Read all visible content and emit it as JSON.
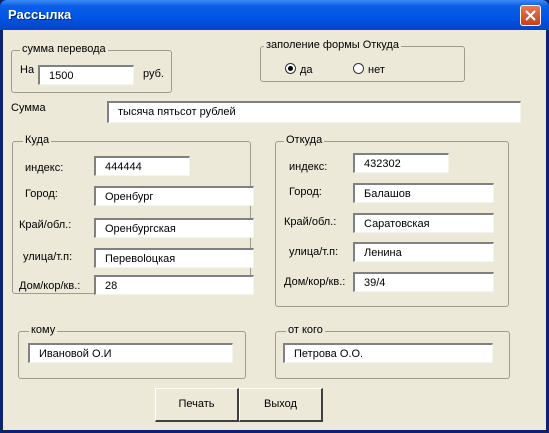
{
  "window": {
    "title": "Рассылка"
  },
  "transfer": {
    "group_label": "сумма перевода",
    "prefix": "На",
    "amount": "1500",
    "currency": "руб."
  },
  "form_from": {
    "group_label": "заполение формы Откуда",
    "option_yes": "да",
    "option_no": "нет",
    "selected": "да"
  },
  "sum": {
    "label": "Сумма",
    "value": "тысяча пятьсот рублей"
  },
  "to_address": {
    "group_label": "Куда",
    "fields": [
      {
        "label": "индекс:",
        "value": "444444"
      },
      {
        "label": "Город:",
        "value": "Оренбург"
      },
      {
        "label": "Край/обл.:",
        "value": "Оренбургская"
      },
      {
        "label": "улица/т.п:",
        "value": "Перевolоцкая"
      },
      {
        "label": "Дом/кор/кв.:",
        "value": "28"
      }
    ]
  },
  "from_address": {
    "group_label": "Откуда",
    "fields": [
      {
        "label": "индекс:",
        "value": "432302"
      },
      {
        "label": "Город:",
        "value": "Балашов"
      },
      {
        "label": "Край/обл.:",
        "value": "Саратовская"
      },
      {
        "label": "улица/т.п:",
        "value": "Ленина"
      },
      {
        "label": "Дом/кор/кв.:",
        "value": "39/4"
      }
    ]
  },
  "recipient": {
    "group_label": "кому",
    "value": "Ивановой О.И"
  },
  "sender": {
    "group_label": "от кого",
    "value": "Петрова О.О."
  },
  "buttons": {
    "print": "Печать",
    "exit": "Выход"
  }
}
